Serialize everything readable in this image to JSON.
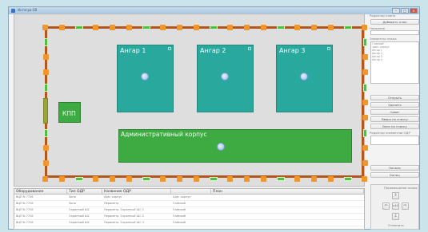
{
  "window": {
    "title": "Интегра-SB"
  },
  "plan": {
    "hangars": [
      {
        "label": "Ангар 1"
      },
      {
        "label": "Ангар 2"
      },
      {
        "label": "Ангар 3"
      }
    ],
    "admin_label": "Административный корпус",
    "kpp_label": "КПП"
  },
  "side_panel": {
    "section_title": "Редактор плана",
    "add_plan_label": "Добавить план",
    "name_label": "Название",
    "name_value": "",
    "element_label": "Элементы плана",
    "elements": [
      "Главный",
      "здан. корпус",
      "Ангар 1",
      "Ангар 2",
      "Ангар 3",
      "Ангар 4"
    ],
    "buttons": [
      "Открыть",
      "Удалить",
      "Сдвиг",
      "Вверх по списку",
      "Вниз по списку"
    ],
    "editor_label": "Редактор элементов ОДР",
    "buttons_bottom": [
      "Начало",
      "Конец"
    ],
    "move_title": "Перемещение плана",
    "move_center": "x10",
    "move_bottom": "Отменить"
  },
  "table": {
    "columns": [
      "Оборудование",
      "Тип ОДР",
      "Название ОДР",
      "",
      "План"
    ],
    "rows": [
      [
        "ВЦП N 7726",
        "Зона",
        "Адм. корпус",
        "Адм. корпус",
        ""
      ],
      [
        "ВЦП N 7726",
        "Зона",
        "Периметр",
        "Главный",
        ""
      ],
      [
        "ВЦП N 7726",
        "Охранный ШС",
        "Периметр. Охранный ШС 1",
        "Главный",
        ""
      ],
      [
        "ВЦП N 7726",
        "Охранный ШС",
        "Периметр. Охранный ШС 2",
        "Главный",
        ""
      ],
      [
        "ВЦП N 7726",
        "Охранный ШС",
        "Периметр. Охранный ШС 3",
        "Главный",
        ""
      ]
    ]
  },
  "colors": {
    "fence": "#b2571d",
    "hangar": "#29a99e",
    "building": "#3daa42",
    "post": "#f0962a"
  }
}
